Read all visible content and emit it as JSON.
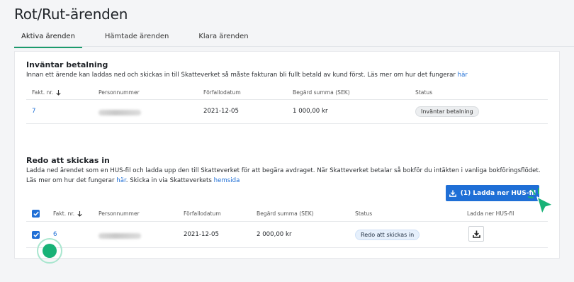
{
  "page": {
    "title": "Rot/Rut-ärenden"
  },
  "tabs": [
    {
      "label": "Aktiva ärenden",
      "active": true
    },
    {
      "label": "Hämtade ärenden",
      "active": false
    },
    {
      "label": "Klara ärenden",
      "active": false
    }
  ],
  "awaiting": {
    "title": "Inväntar betalning",
    "desc_text": "Innan ett ärende kan laddas ned och skickas in till Skatteverket så måste fakturan bli fullt betald av kund först. Läs mer om hur det fungerar ",
    "desc_link": "här",
    "columns": [
      "Fakt. nr.",
      "Personnummer",
      "Förfallodatum",
      "Begärd summa (SEK)",
      "Status"
    ],
    "rows": [
      {
        "invoice": "7",
        "due": "2021-12-05",
        "amount": "1 000,00 kr",
        "status": "Inväntar betalning"
      }
    ]
  },
  "ready": {
    "title": "Redo att skickas in",
    "desc_text1": "Ladda ned ärendet som en HUS-fil och ladda upp den till Skatteverket för att begära avdraget. När Skatteverket betalar så bokför du intäkten i vanliga bokföringsflödet. Läs mer om hur det fungerar ",
    "desc_link1": "här",
    "desc_text2": ". Skicka in via Skatteverkets ",
    "desc_link2": "hemsida",
    "download_button": "(1) Ladda ner HUS-fil",
    "columns": [
      "Fakt. nr.",
      "Personnummer",
      "Förfallodatum",
      "Begärd summa (SEK)",
      "Status",
      "Ladda ner HUS-fil"
    ],
    "rows": [
      {
        "invoice": "6",
        "due": "2021-12-05",
        "amount": "2 000,00 kr",
        "status": "Redo att skickas in",
        "checked": true
      }
    ]
  },
  "colors": {
    "accent": "#1f6fd6",
    "tab_underline": "#1a9b6c",
    "cursor": "#18b277"
  },
  "icons": {
    "sort": "arrow-down-icon",
    "download": "download-icon",
    "check": "check-icon",
    "cursor": "pointer-cursor-icon"
  }
}
